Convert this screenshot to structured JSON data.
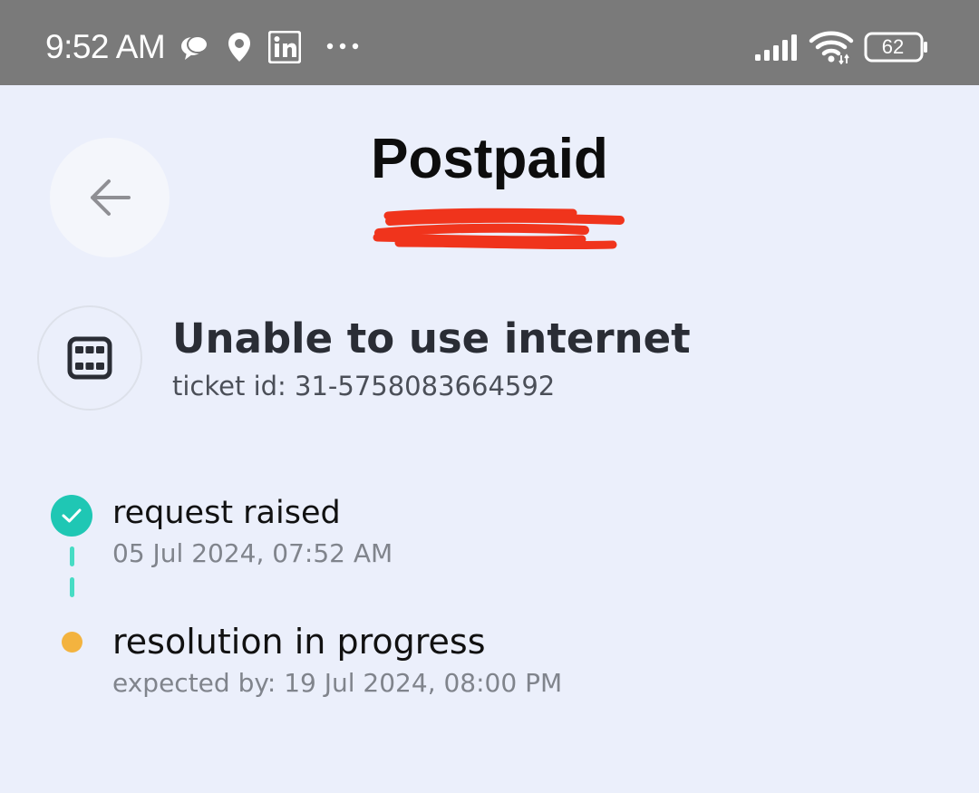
{
  "status_bar": {
    "time": "9:52 AM",
    "battery_level": "62",
    "icons": [
      "chat-bubble-icon",
      "location-icon",
      "linkedin-icon",
      "more-dots-icon",
      "signal-icon",
      "wifi-icon",
      "battery-icon"
    ]
  },
  "header": {
    "title": "Postpaid",
    "back_icon": "arrow-left-icon"
  },
  "ticket": {
    "icon": "sim-card-icon",
    "title": "Unable to use internet",
    "id_text": "ticket id: 31-5758083664592"
  },
  "timeline": [
    {
      "label": "request raised",
      "detail": "05 Jul 2024, 07:52 AM",
      "status": "done",
      "color": "#1fc7b4"
    },
    {
      "label": "resolution in progress",
      "detail": "expected by: 19 Jul 2024, 08:00 PM",
      "status": "pending",
      "color": "#f3b33f"
    }
  ],
  "colors": {
    "background": "#ebeffb",
    "status_bar": "#7a7a7a",
    "redaction": "#f0341c"
  }
}
